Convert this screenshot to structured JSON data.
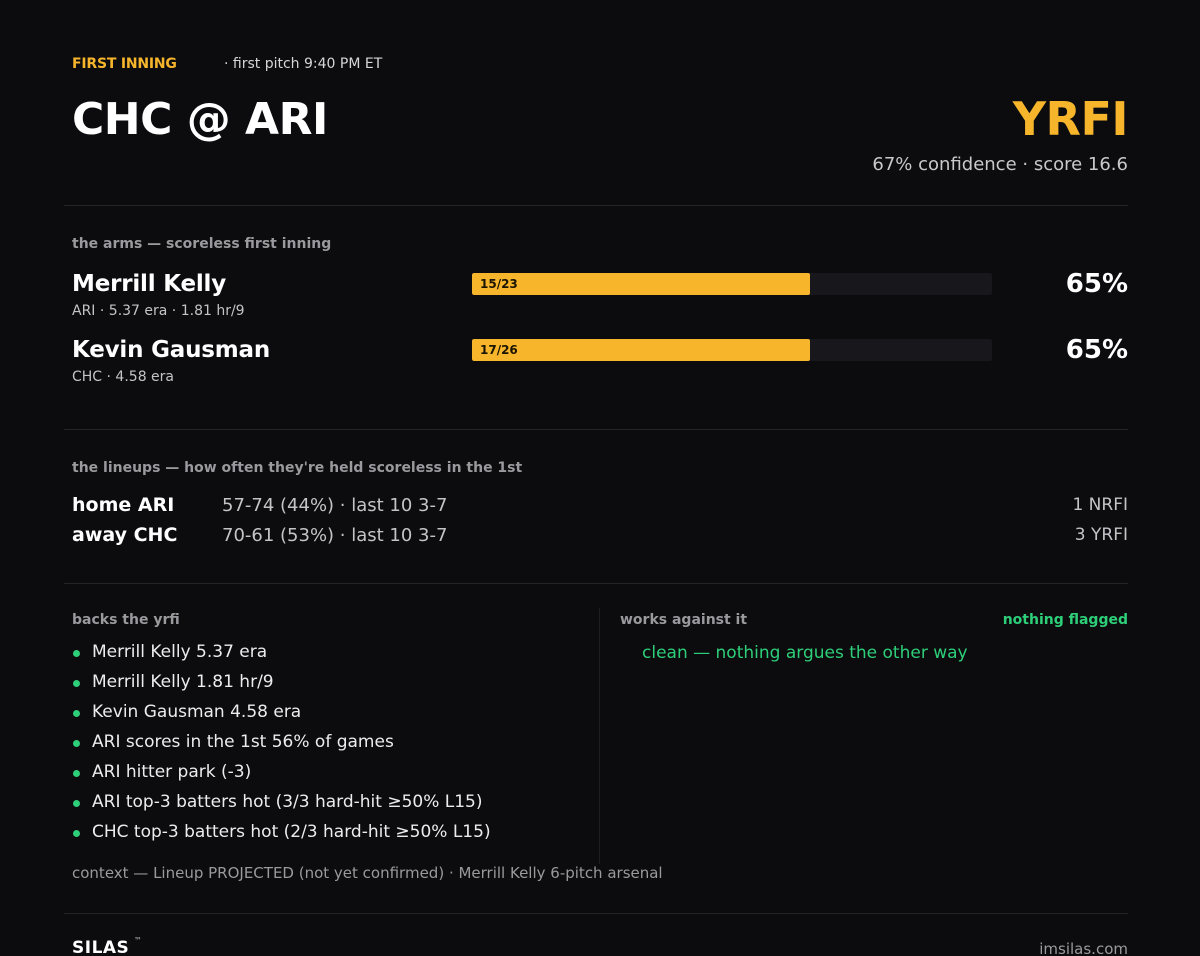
{
  "header": {
    "kicker": "FIRST INNING",
    "first_pitch": "· first pitch 9:40 PM ET",
    "matchup": "CHC @ ARI",
    "verdict": "YRFI",
    "verdict_sub": "67% confidence · score 16.6"
  },
  "arms": {
    "label": "the arms — scoreless first inning",
    "pitchers": [
      {
        "name": "Merrill Kelly",
        "meta": "ARI  ·  5.37 era  ·  1.81 hr/9",
        "record": "15/23",
        "fraction": 0.65,
        "pct": "65%"
      },
      {
        "name": "Kevin Gausman",
        "meta": "CHC  ·  4.58 era",
        "record": "17/26",
        "fraction": 0.65,
        "pct": "65%"
      }
    ]
  },
  "lineups": {
    "label": "the lineups — how often they're held scoreless in the 1st",
    "rows": [
      {
        "side": "home ARI",
        "stats": "57-74 (44%)  ·  last 10  3-7",
        "result": "1 NRFI"
      },
      {
        "side": "away CHC",
        "stats": "70-61 (53%)  ·  last 10  3-7",
        "result": "3 YRFI"
      }
    ]
  },
  "factors": {
    "pro_label": "backs the yrfi",
    "pro": [
      "Merrill Kelly 5.37 era",
      "Merrill Kelly 1.81 hr/9",
      "Kevin Gausman 4.58 era",
      "ARI scores in the 1st 56% of games",
      "ARI hitter park (-3)",
      "ARI top-3 batters hot (3/3 hard-hit ≥50% L15)",
      "CHC top-3 batters hot (2/3 hard-hit ≥50% L15)"
    ],
    "con_label": "works against it",
    "con_flag": "nothing flagged",
    "con_clean": "clean — nothing argues the other way",
    "context": "context — Lineup PROJECTED (not yet confirmed)  ·  Merrill Kelly 6-pitch arsenal"
  },
  "footer": {
    "brand": "SILAS",
    "tm": "™",
    "site": "imsilas.com"
  },
  "colors": {
    "accent": "#f7b52c",
    "positive": "#2ecf79",
    "background": "#0c0c0f"
  }
}
